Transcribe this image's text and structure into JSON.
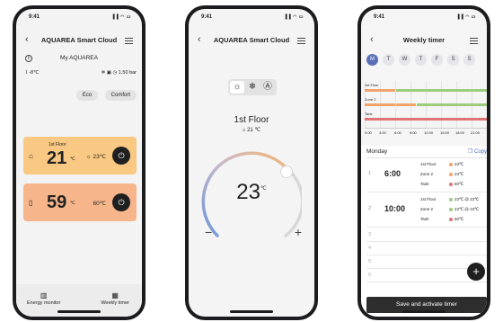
{
  "status": {
    "time": "9:41",
    "signal": "▐▐ ◠ ▭"
  },
  "screen1": {
    "title": "AQUAREA Smart Cloud",
    "location": "My AQUAREA",
    "outdoor_temp": "-8",
    "temp_unit": "℃",
    "pressure": "1.50",
    "pressure_unit": "bar",
    "modes": [
      "Eco",
      "Comfort"
    ],
    "zone1": {
      "label": "1st Floor",
      "temp": "21",
      "target": "23"
    },
    "tank": {
      "temp": "59",
      "target": "60"
    },
    "nav": {
      "energy": "Energy monitor",
      "timer": "Weekly timer"
    }
  },
  "screen2": {
    "title": "AQUAREA Smart Cloud",
    "zone": "1st Floor",
    "current_temp": "21",
    "set_temp": "23",
    "temp_unit": "℃",
    "minus": "−",
    "plus": "+"
  },
  "screen3": {
    "title": "Weekly timer",
    "days": [
      "M",
      "T",
      "W",
      "T",
      "F",
      "S",
      "S"
    ],
    "timeline_rows": [
      "1st Floor",
      "Zone 2",
      "Tank"
    ],
    "time_axis": [
      "0:00",
      "3:00",
      "6:00",
      "9:00",
      "12:00",
      "15:00",
      "18:00",
      "21:00"
    ],
    "day_name": "Monday",
    "copy_label": "Copy",
    "slots": [
      {
        "num": "1",
        "time": "6:00",
        "zones": [
          "1st Floor",
          "Zone 2",
          "Tank"
        ],
        "values": [
          "23℃",
          "23℃",
          "60℃"
        ]
      },
      {
        "num": "2",
        "time": "10:00",
        "zones": [
          "1st Floor",
          "Zone 2",
          "Tank"
        ],
        "values": [
          "23℃  @ 23℃",
          "23℃  @ 23℃",
          "60℃"
        ]
      }
    ],
    "empty_slots": [
      "3",
      "4",
      "5",
      "6"
    ],
    "fab": "+",
    "cta": "Save and activate timer"
  }
}
